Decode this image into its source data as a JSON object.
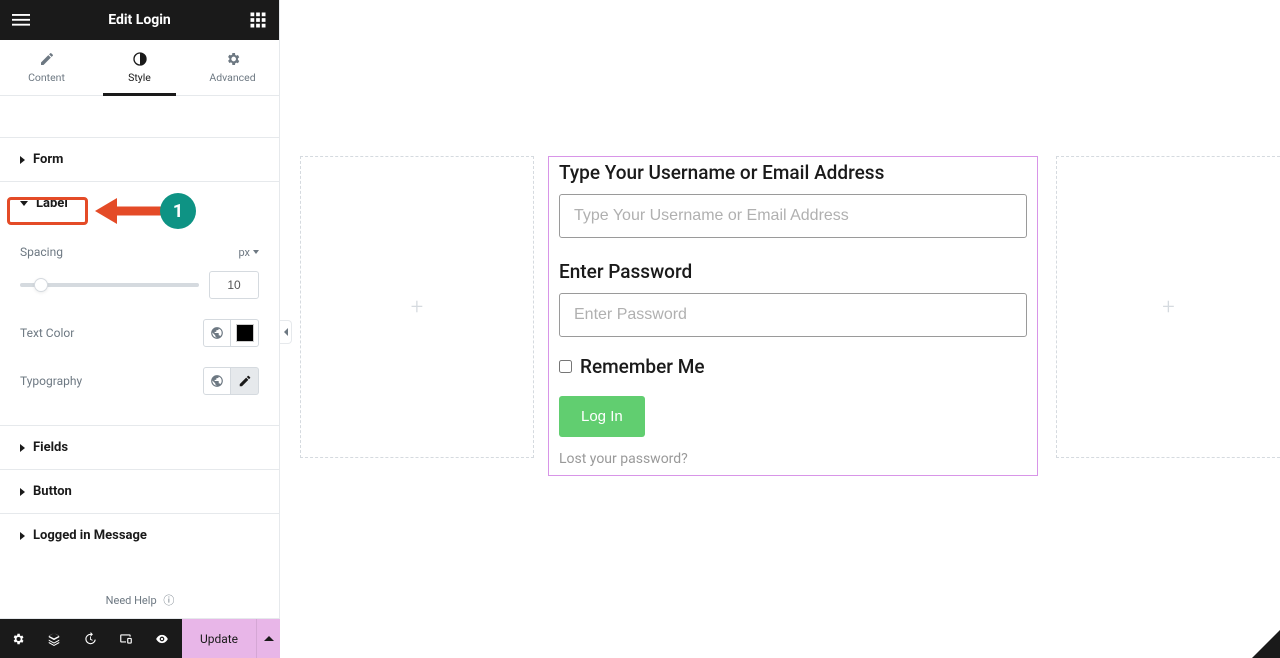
{
  "header": {
    "title": "Edit Login"
  },
  "tabs": {
    "content": "Content",
    "style": "Style",
    "advanced": "Advanced"
  },
  "sections": {
    "form": "Form",
    "label": "Label",
    "fields": "Fields",
    "button": "Button",
    "logged_in": "Logged in Message"
  },
  "label_controls": {
    "spacing": {
      "label": "Spacing",
      "unit": "px",
      "value": "10"
    },
    "text_color": {
      "label": "Text Color",
      "swatch": "#000000"
    },
    "typography": {
      "label": "Typography"
    }
  },
  "help": {
    "text": "Need Help"
  },
  "footer": {
    "update": "Update"
  },
  "annotation": {
    "badge": "1"
  },
  "canvas": {
    "username_label": "Type Your Username or Email Address",
    "username_placeholder": "Type Your Username or Email Address",
    "password_label": "Enter Password",
    "password_placeholder": "Enter Password",
    "remember": "Remember Me",
    "login_button": "Log In",
    "lost_password": "Lost your password?"
  }
}
